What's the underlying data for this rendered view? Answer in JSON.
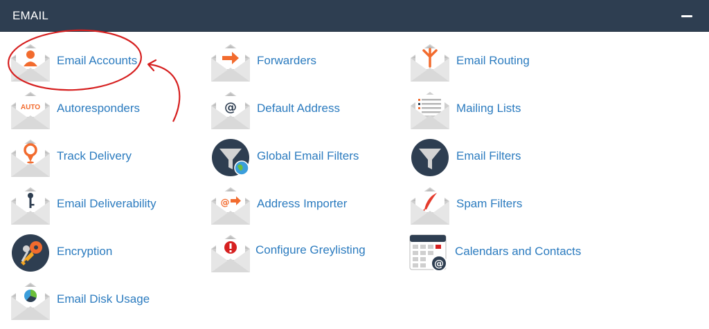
{
  "section": {
    "title": "EMAIL"
  },
  "items": {
    "email_accounts": "Email Accounts",
    "forwarders": "Forwarders",
    "email_routing": "Email Routing",
    "autoresponders": "Autoresponders",
    "default_address": "Default Address",
    "mailing_lists": "Mailing Lists",
    "track_delivery": "Track Delivery",
    "global_email_filters": "Global Email Filters",
    "email_filters": "Email Filters",
    "email_deliverability": "Email Deliverability",
    "address_importer": "Address Importer",
    "spam_filters": "Spam Filters",
    "encryption": "Encryption",
    "configure_greylisting": "Configure Greylisting",
    "calendars_and_contacts": "Calendars and Contacts",
    "email_disk_usage": "Email Disk Usage"
  },
  "icon_text": {
    "auto": "AUTO"
  },
  "colors": {
    "header": "#2e3e51",
    "link": "#2b7bbf",
    "accent_orange": "#f26b2e",
    "annotation_red": "#d62020",
    "envelope": "#dcdcdc",
    "dark_circle": "#2e3e51"
  }
}
